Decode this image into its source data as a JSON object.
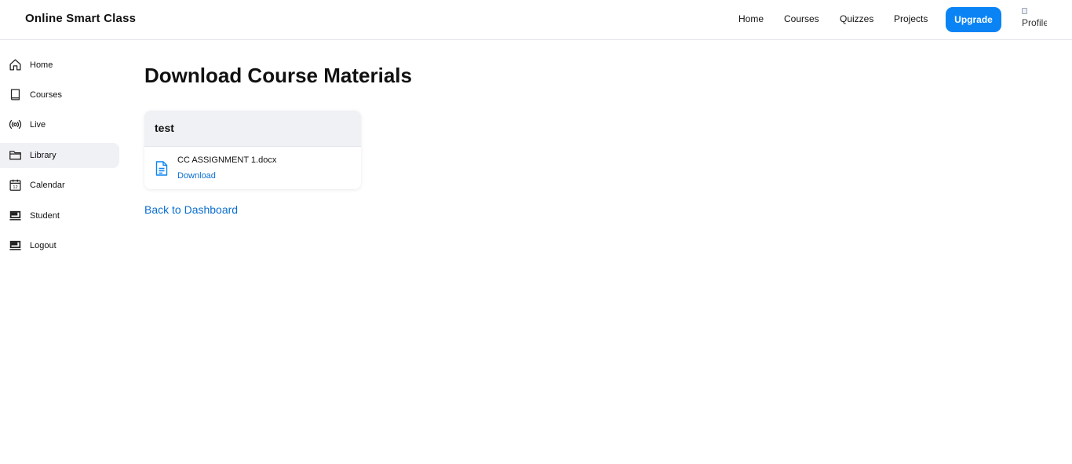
{
  "header": {
    "brand": "Online Smart Class",
    "nav": [
      {
        "label": "Home"
      },
      {
        "label": "Courses"
      },
      {
        "label": "Quizzes"
      },
      {
        "label": "Projects"
      }
    ],
    "upgrade_label": "Upgrade",
    "avatar_alt": "Profile"
  },
  "sidebar": {
    "items": [
      {
        "label": "Home",
        "icon": "home-icon"
      },
      {
        "label": "Courses",
        "icon": "book-icon"
      },
      {
        "label": "Live",
        "icon": "broadcast-icon"
      },
      {
        "label": "Library",
        "icon": "folder-icon",
        "active": true
      },
      {
        "label": "Calendar",
        "icon": "calendar-icon"
      },
      {
        "label": "Student",
        "icon": "monitor-icon"
      },
      {
        "label": "Logout",
        "icon": "monitor-icon"
      }
    ]
  },
  "main": {
    "title": "Download Course Materials",
    "card": {
      "heading": "test",
      "file_name": "CC ASSIGNMENT 1.docx",
      "download_label": "Download"
    },
    "back_label": "Back to Dashboard"
  },
  "colors": {
    "accent": "#0a84f5",
    "link": "#0a6ed1",
    "active_bg": "#f0f1f4"
  }
}
